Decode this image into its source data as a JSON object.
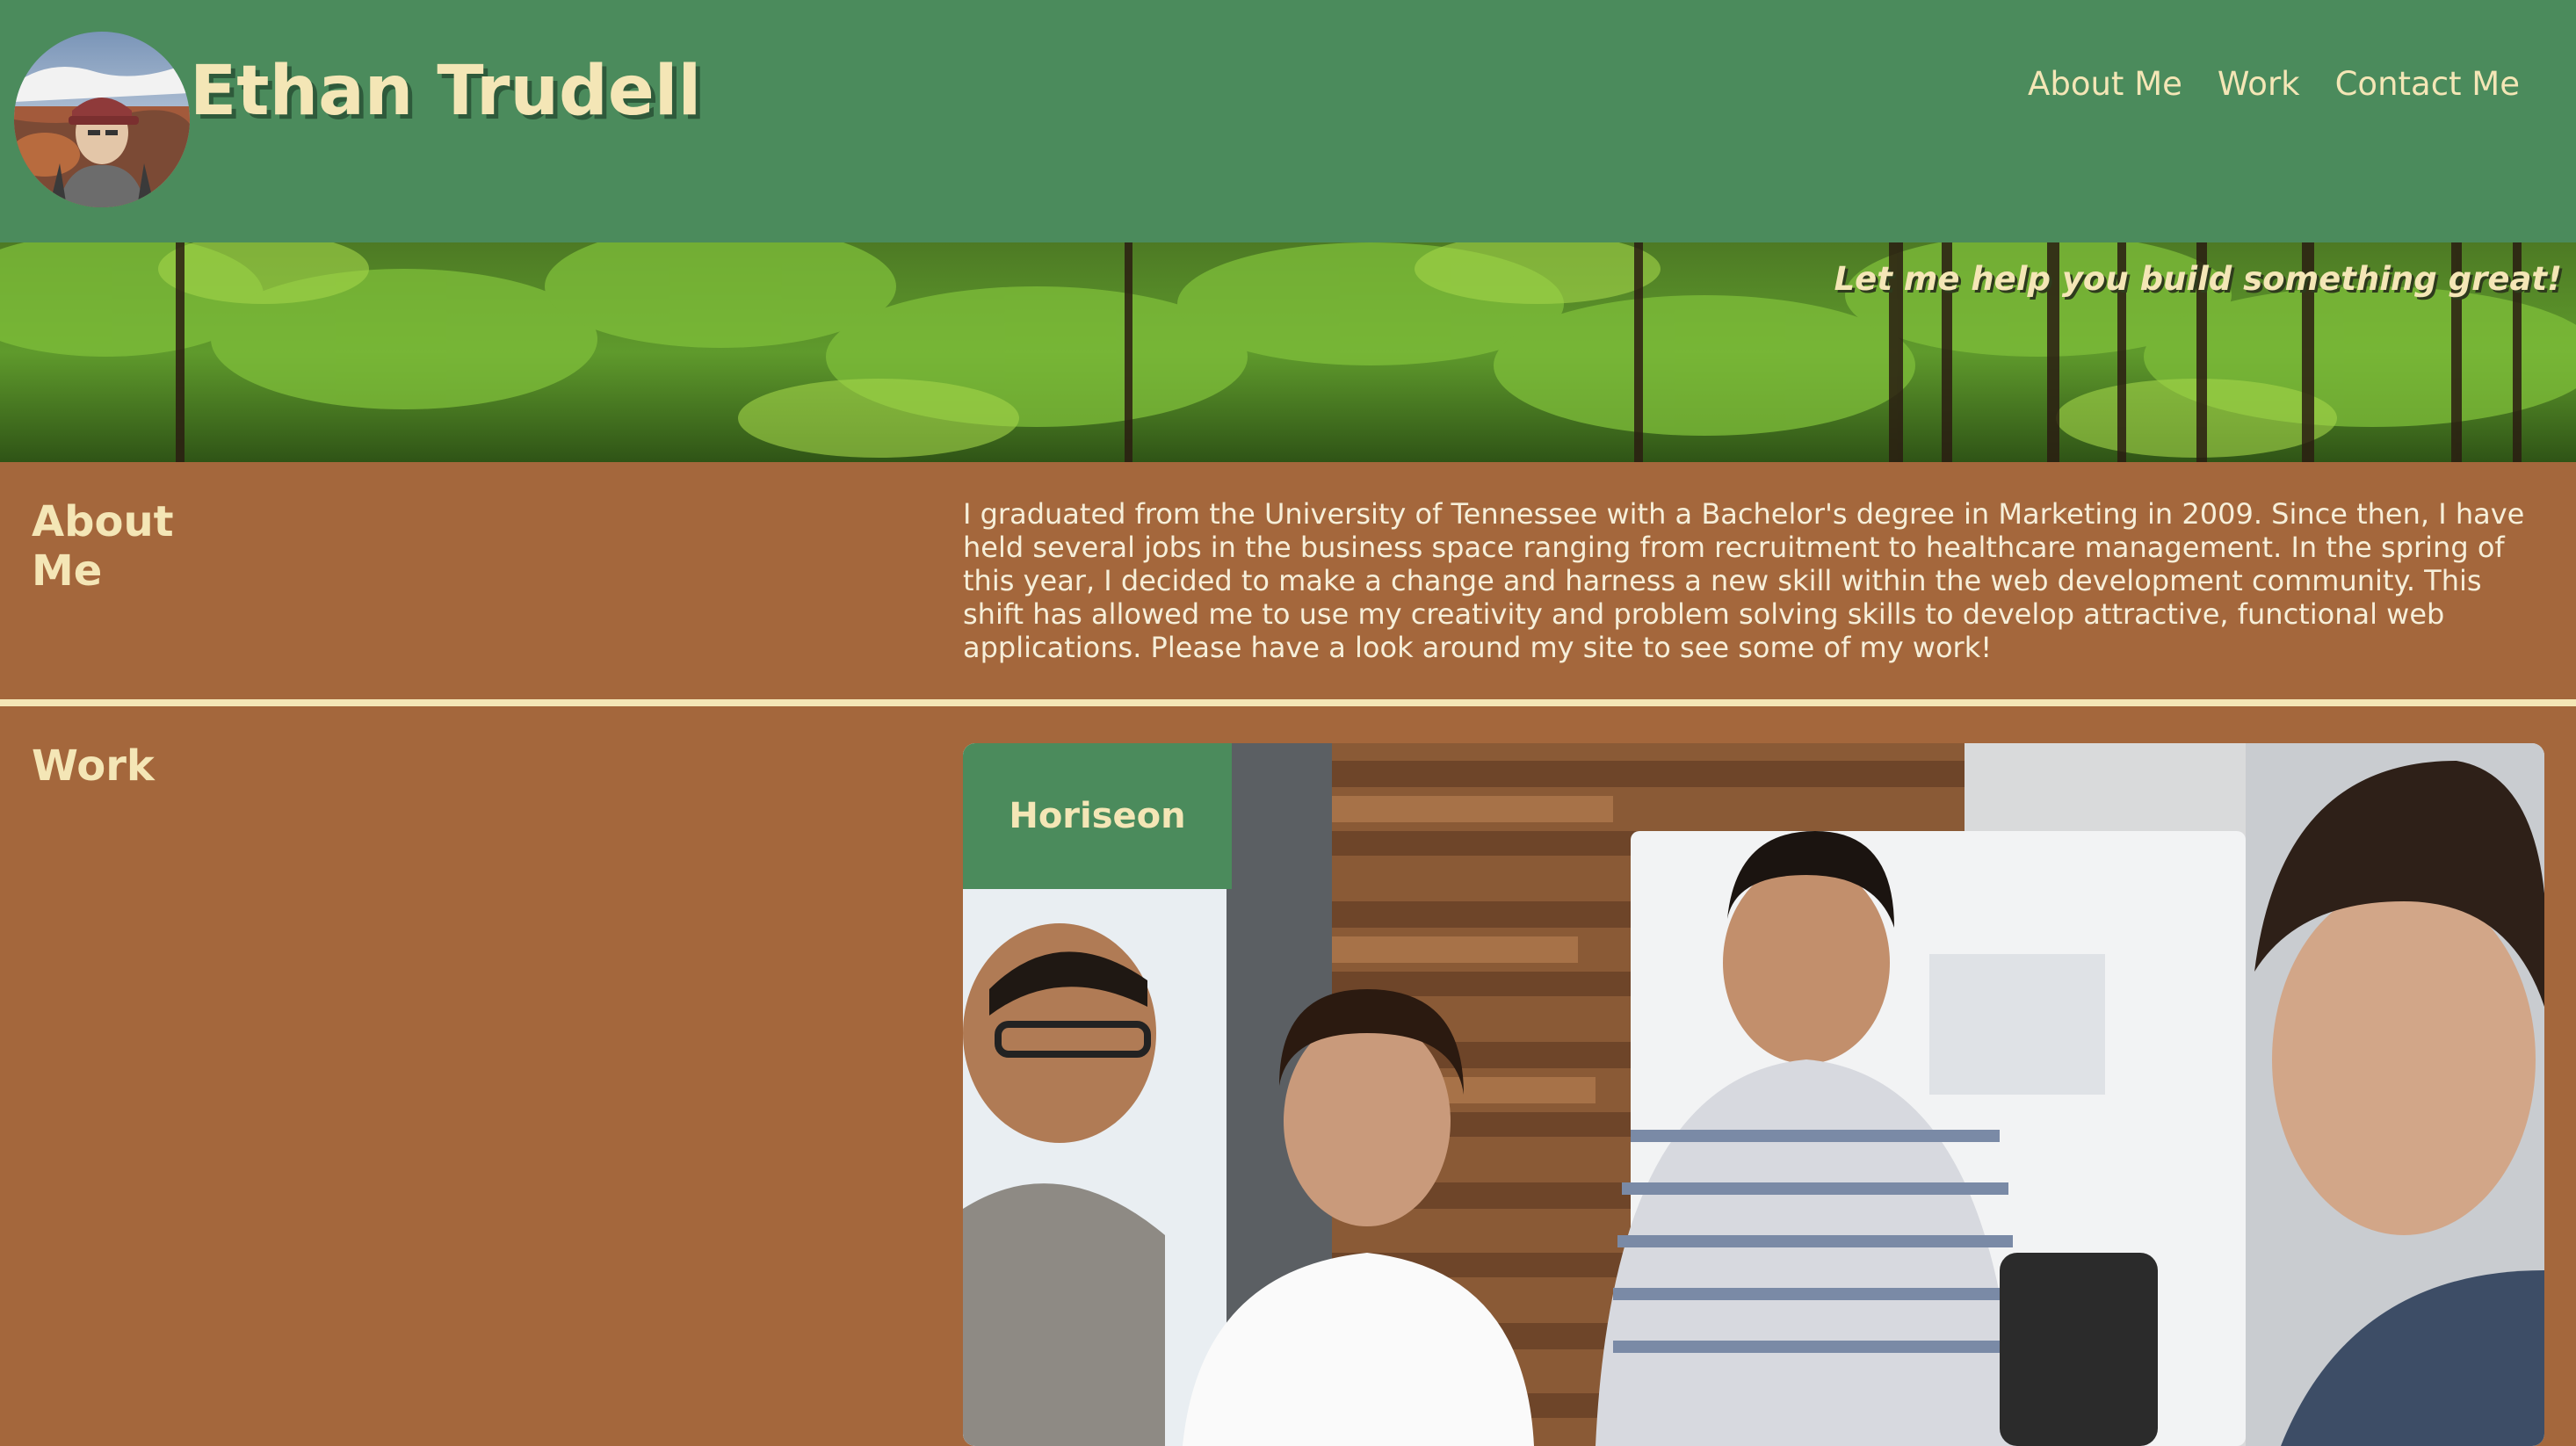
{
  "header": {
    "name": "Ethan Trudell",
    "nav": [
      {
        "label": "About Me"
      },
      {
        "label": "Work"
      },
      {
        "label": "Contact Me"
      }
    ]
  },
  "hero": {
    "tagline": "Let me help you build something great!"
  },
  "about": {
    "heading": "About Me",
    "text": "I graduated from the University of Tennessee with a Bachelor's degree in Marketing in 2009. Since then, I have held several jobs in the business space ranging from recruitment to healthcare management. In the spring of this year, I decided to make a change and harness a new skill within the web development community. This shift has allowed me to use my creativity and problem solving skills to develop attractive, functional web applications. Please have a look around my site to see some of my work!"
  },
  "work": {
    "heading": "Work",
    "projects": [
      {
        "label": "Horiseon"
      }
    ]
  },
  "colors": {
    "header_green": "#4b8b5c",
    "section_brown": "#a4673c",
    "accent_cream": "#f4e6b6"
  }
}
